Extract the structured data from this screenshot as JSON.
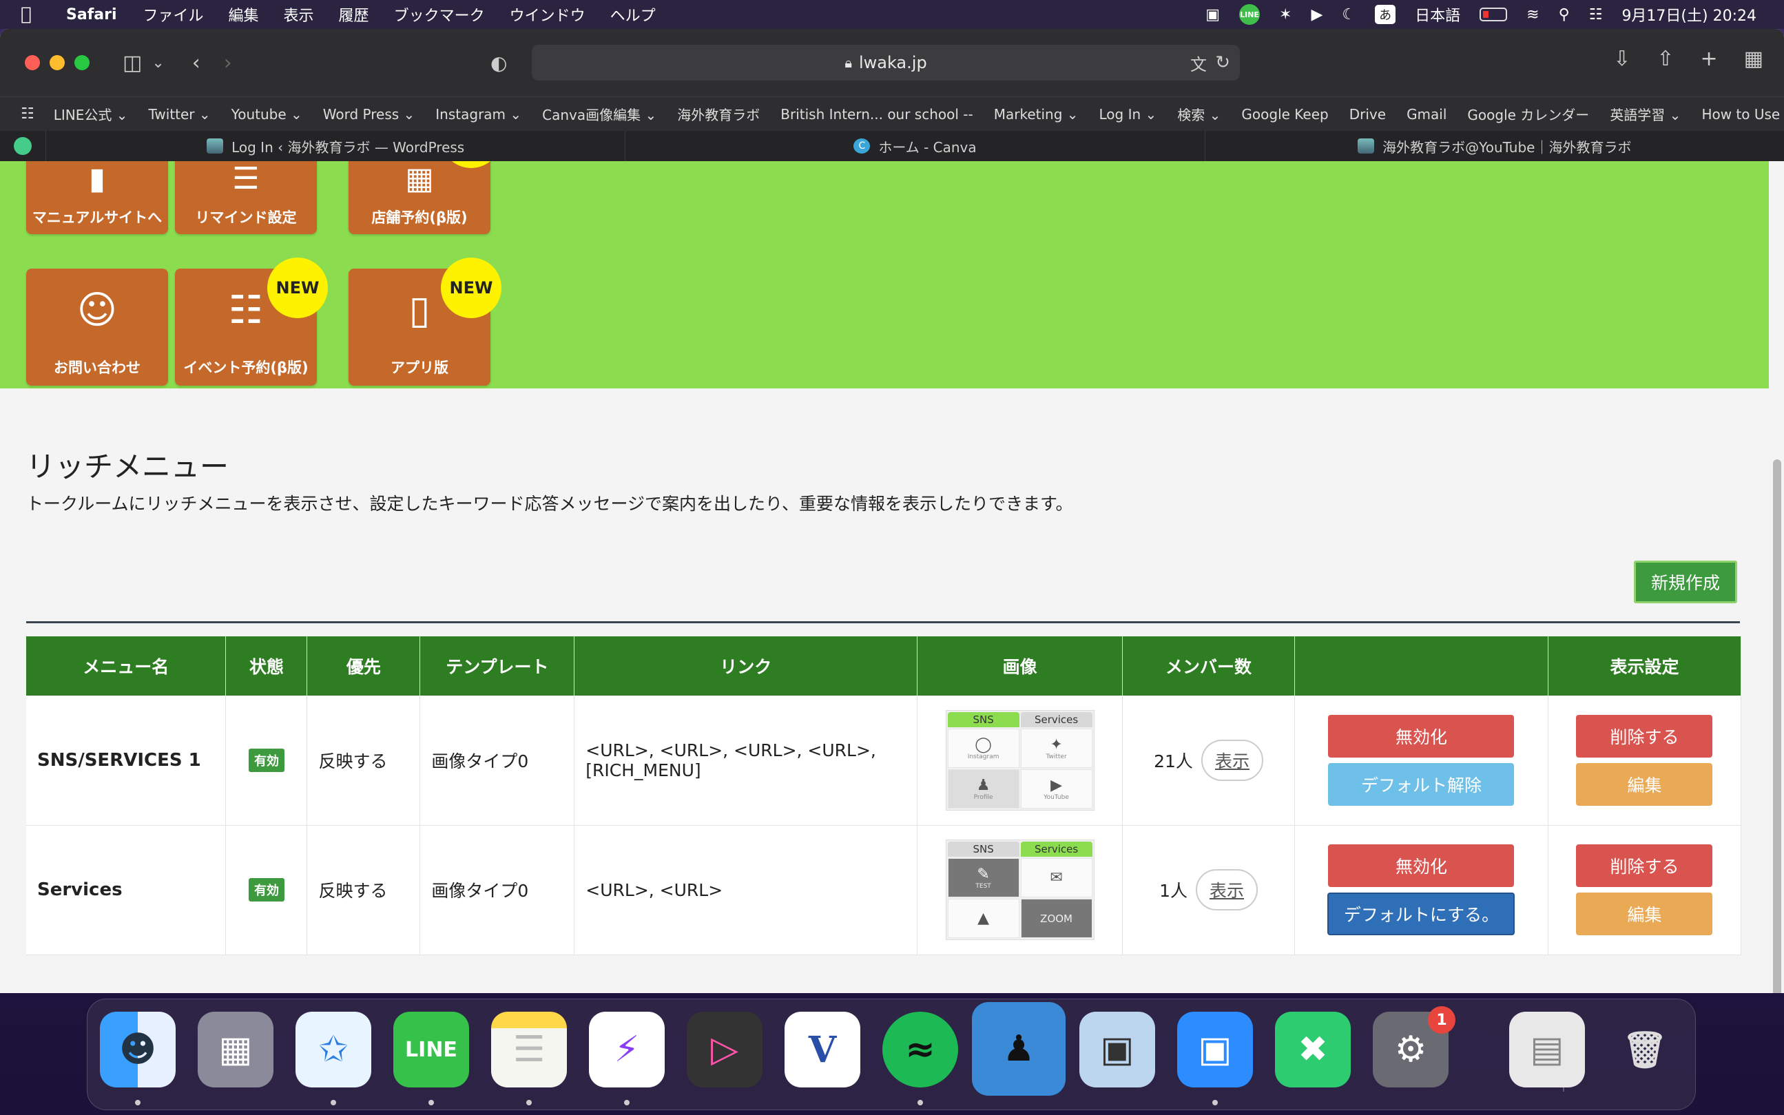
{
  "menubar": {
    "app_name": "Safari",
    "menus": [
      "ファイル",
      "編集",
      "表示",
      "履歴",
      "ブックマーク",
      "ウインドウ",
      "ヘルプ"
    ],
    "line_label": "LINE",
    "ime_glyph": "あ",
    "input_source": "日本語",
    "clock": "9月17日(土)  20:24"
  },
  "toolbar": {
    "url": "lwaka.jp"
  },
  "bookmarks": [
    "LINE公式 ⌄",
    "Twitter ⌄",
    "Youtube ⌄",
    "Word Press ⌄",
    "Instagram ⌄",
    "Canva画像編集 ⌄",
    "海外教育ラボ",
    "British Intern... our school --",
    "Marketing ⌄",
    "Log In ⌄",
    "検索 ⌄",
    "Google Keep",
    "Drive",
    "Gmail",
    "Google カレンダー",
    "英語学習 ⌄",
    "How to Use ⌄"
  ],
  "tabs": [
    "Log In ‹ 海外教育ラボ — WordPress",
    "ホーム - Canva",
    "海外教育ラボ@YouTube｜海外教育ラボ"
  ],
  "tiles": {
    "manual": "マニュアルサイトへ",
    "remind": "リマインド設定",
    "store": "店舗予約(β版)",
    "contact": "お問い合わせ",
    "event": "イベント予約(β版)",
    "app": "アプリ版",
    "new_label": "NEW"
  },
  "section": {
    "title": "リッチメニュー",
    "description": "トークルームにリッチメニューを表示させ、設定したキーワード応答メッセージで案内を出したり、重要な情報を表示したりできます。",
    "new_button": "新規作成"
  },
  "table": {
    "headers": [
      "メニュー名",
      "状態",
      "優先",
      "テンプレート",
      "リンク",
      "画像",
      "メンバー数",
      "",
      "表示設定"
    ],
    "rows": [
      {
        "name": "SNS/SERVICES 1",
        "status": "有効",
        "priority": "反映する",
        "template": "画像タイプ0",
        "links": "<URL>, <URL>, <URL>, <URL>, [RICH_MENU]",
        "image_tabs": [
          "SNS",
          "Services"
        ],
        "image_cells": [
          "Instagram",
          "Twitter",
          "Profile",
          "YouTube"
        ],
        "members": "21人",
        "view": "表示",
        "action1": "無効化",
        "action2": "デフォルト解除",
        "delete": "削除する",
        "edit": "編集"
      },
      {
        "name": "Services",
        "status": "有効",
        "priority": "反映する",
        "template": "画像タイプ0",
        "links": "<URL>, <URL>",
        "image_tabs": [
          "SNS",
          "Services"
        ],
        "image_cells": [
          "TEST",
          "",
          "",
          "ZOOM"
        ],
        "members": "1人",
        "view": "表示",
        "action1": "無効化",
        "action2": "デフォルトにする。",
        "delete": "削除する",
        "edit": "編集"
      }
    ]
  },
  "dock": {
    "line_label": "LINE",
    "vectornator_label": "V",
    "settings_badge": "1"
  },
  "colors": {
    "green_header": "#2e7d22",
    "page_green": "#8bdd4f",
    "tile_orange": "#c5692b",
    "new_badge": "#fff200",
    "danger": "#d9534f",
    "info": "#6ec0e8",
    "primary": "#2f6fb8",
    "warning": "#eaa955"
  }
}
